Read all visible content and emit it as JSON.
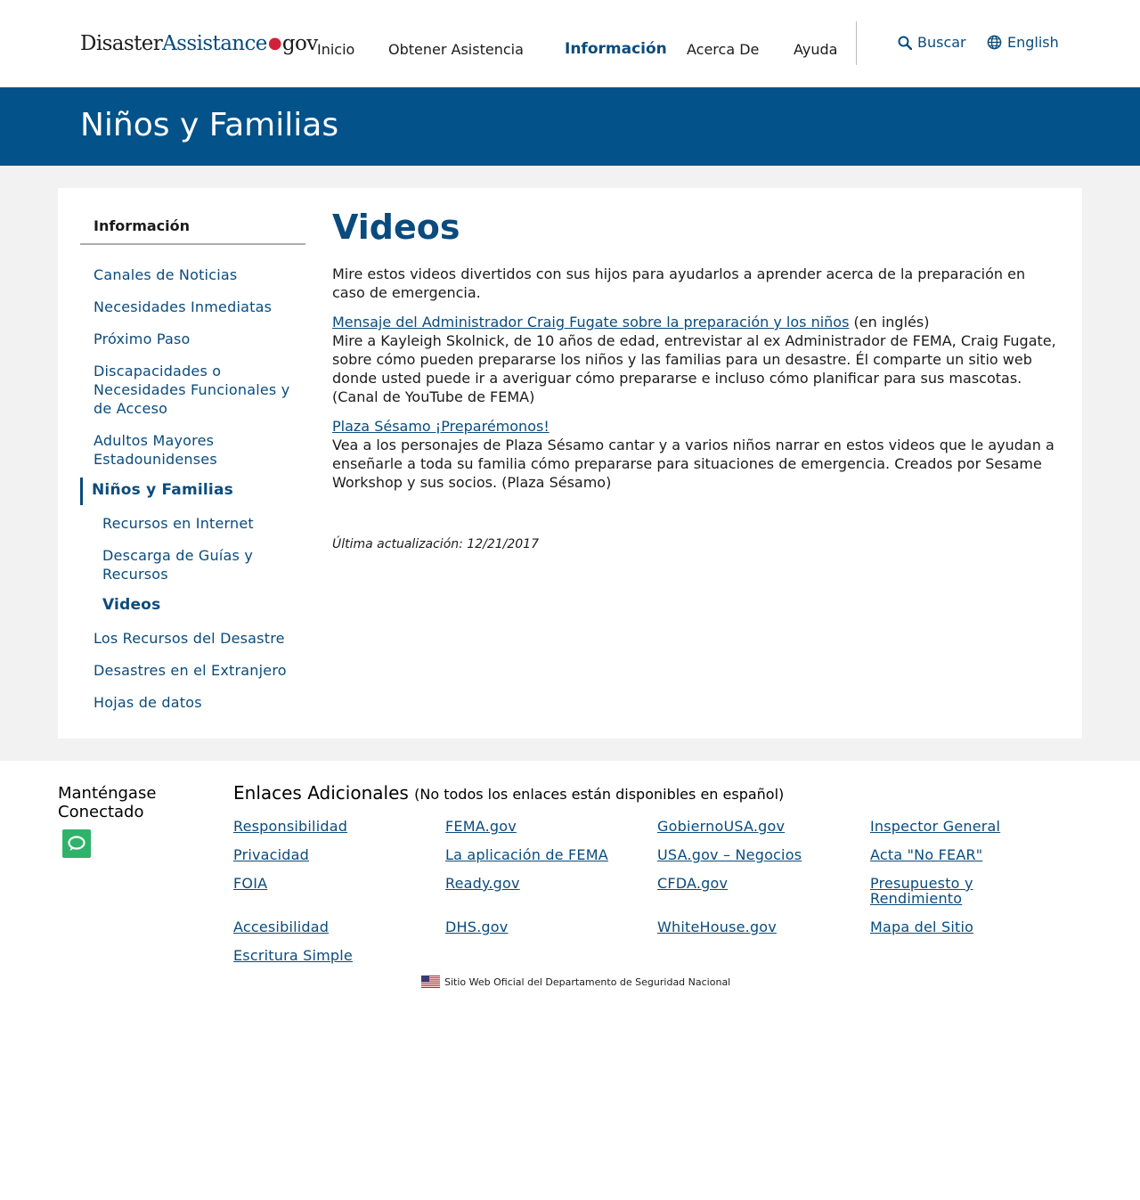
{
  "header": {
    "logo": {
      "part1": "Disaster",
      "part2": "Assistance",
      "dot": "●",
      "part3": "gov"
    },
    "nav": [
      "Inicio",
      "Obtener Asistencia",
      "Información",
      "Acerca De",
      "Ayuda"
    ],
    "active_nav": "Información",
    "search_label": "Buscar",
    "language_label": "English"
  },
  "banner": {
    "title": "Niños y Familias"
  },
  "sidebar": {
    "title": "Información",
    "items": [
      "Canales de Noticias",
      "Necesidades Inmediatas",
      "Próximo Paso",
      "Discapacidades o Necesidades Funcionales y de Acceso",
      "Adultos Mayores Estadounidenses",
      "Niños y Familias",
      "Recursos en Internet",
      "Descarga de Guías y Recursos",
      "Videos",
      "Los Recursos del Desastre",
      "Desastres en el Extranjero",
      "Hojas de datos"
    ]
  },
  "content": {
    "title": "Videos",
    "intro": "Mire estos videos divertidos con sus hijos para ayudarlos a aprender acerca de la preparación en caso de emergencia.",
    "video1": {
      "link": "Mensaje del Administrador Craig Fugate sobre la preparación y los niños",
      "suffix": " (en inglés)",
      "description": "Mire a Kayleigh Skolnick, de 10 años de edad, entrevistar al ex Administrador de FEMA, Craig Fugate, sobre cómo pueden prepararse los niños y las familias para un desastre. Él comparte un sitio web donde usted puede ir a averiguar cómo prepararse e incluso cómo planificar para sus mascotas. (Canal de YouTube de FEMA)"
    },
    "video2": {
      "link": "Plaza Sésamo ¡Preparémonos!",
      "description": "Vea a los personajes de Plaza Sésamo cantar y a varios niños narrar en estos videos que le ayudan a enseñarle a toda su familia cómo prepararse para situaciones de emergencia. Creados por Sesame Workshop y sus socios. (Plaza Sésamo)"
    },
    "updated": "Última actualización: 12/21/2017"
  },
  "footer": {
    "stay_connected": "Manténgase Conectado",
    "links_title": "Enlaces Adicionales",
    "links_subtitle": "(No todos los enlaces están disponibles en español)",
    "links": [
      "Responsibilidad",
      "FEMA.gov",
      "GobiernoUSA.gov",
      "Inspector General",
      "Privacidad",
      "La aplicación de FEMA",
      "USA.gov – Negocios",
      "Acta \"No FEAR\"",
      "FOIA",
      "Ready.gov",
      "CFDA.gov",
      "Presupuesto y Rendimiento",
      "Accesibilidad",
      "DHS.gov",
      "WhiteHouse.gov",
      "Mapa del Sitio",
      "Escritura Simple"
    ],
    "official_site": "Sitio Web Oficial del Departamento de Seguridad Nacional"
  },
  "colors": {
    "primary": "#0a4b7d",
    "banner": "#03528a",
    "chat": "#2fb36b",
    "logo_dot": "#d1213a"
  }
}
